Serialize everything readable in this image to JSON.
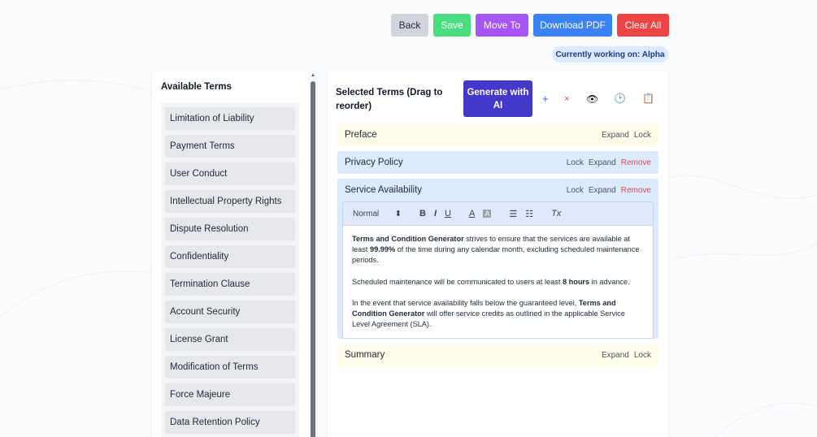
{
  "toolbar": {
    "back_label": "Back",
    "save_label": "Save",
    "move_label": "Move To",
    "download_label": "Download PDF",
    "clear_label": "Clear All"
  },
  "working": {
    "label": "Currently working on: Alpha"
  },
  "available": {
    "title": "Available Terms",
    "items": [
      "Limitation of Liability",
      "Payment Terms",
      "User Conduct",
      "Intellectual Property Rights",
      "Dispute Resolution",
      "Confidentiality",
      "Termination Clause",
      "Account Security",
      "License Grant",
      "Modification of Terms",
      "Force Majeure",
      "Data Retention Policy"
    ]
  },
  "selected": {
    "title": "Selected Terms (Drag to reorder)",
    "generate_label": "Generate with AI",
    "icons": {
      "add": "+",
      "remove": "×",
      "preview": "👁",
      "history": "🕑",
      "clipboard": "📋"
    },
    "actions": {
      "expand": "Expand",
      "lock": "Lock",
      "remove": "Remove"
    },
    "sections": [
      {
        "title": "Preface"
      },
      {
        "title": "Privacy Policy"
      },
      {
        "title": "Service Availability"
      },
      {
        "title": "Summary"
      }
    ]
  },
  "editor": {
    "format": "Normal",
    "toolbar": {
      "bold": "B",
      "italic": "I",
      "underline": "U",
      "color": "A",
      "bg": "A",
      "clear": "Tx"
    },
    "p1": {
      "b1": "Terms and Condition Generator",
      "t1": " strives to ensure that the services are available at least ",
      "b2": "99.99%",
      "t2": " of the time during any calendar month, excluding scheduled maintenance periods."
    },
    "p2": {
      "t1": "Scheduled maintenance will be communicated to users at least ",
      "b1": "8 hours",
      "t2": " in advance."
    },
    "p3": {
      "t1": "In the event that service availability falls below the guaranteed level, ",
      "b1": "Terms and Condition Generator",
      "t2": " will offer service credits as outlined in the applicable Service Level Agreement (SLA)."
    }
  },
  "colors": {
    "back": "#d1d5db",
    "save": "#4ade80",
    "move": "#a855f7",
    "pdf": "#3b82f6",
    "clear": "#ef4444",
    "ai": "#4338ca",
    "badge_bg": "#dbeafe",
    "remove": "#ef4444"
  }
}
